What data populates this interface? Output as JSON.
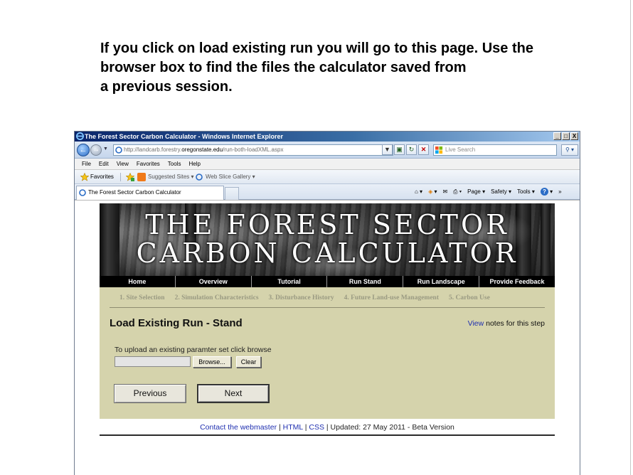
{
  "caption": {
    "lines": [
      "If you click on load existing run you will go to this page.  Use the",
      "browser box to find the files the calculator saved from",
      "a previous session."
    ]
  },
  "browser": {
    "window_title": "The Forest Sector Carbon Calculator - Windows Internet Explorer",
    "window_buttons": [
      "_",
      "□",
      "X"
    ],
    "address": {
      "prefix": "http://landcarb.forestry.",
      "domain": "oregonstate.edu",
      "path": "/run-both-loadXML.aspx"
    },
    "search_placeholder": "Live Search",
    "menu": [
      "File",
      "Edit",
      "View",
      "Favorites",
      "Tools",
      "Help"
    ],
    "favorites_label": "Favorites",
    "suggested_sites": "Suggested Sites ▾",
    "web_slice_gallery": "Web Slice Gallery ▾",
    "tab_title": "The Forest Sector Carbon Calculator",
    "command_bar": {
      "page": "Page ▾",
      "safety": "Safety ▾",
      "tools": "Tools ▾"
    }
  },
  "site": {
    "banner": {
      "line1": "THE FOREST SECTOR",
      "line2": "CARBON CALCULATOR"
    },
    "nav": [
      "Home",
      "Overview",
      "Tutorial",
      "Run Stand",
      "Run Landscape",
      "Provide Feedback"
    ],
    "steps": [
      "1. Site Selection",
      "2. Simulation Characteristics",
      "3. Disturbance History",
      "4. Future Land-use Management",
      "5. Carbon Use"
    ],
    "page_title": "Load Existing Run - Stand",
    "notes": {
      "link": "View",
      "text": " notes for this step"
    },
    "upload_label": "To upload an existing paramter set click browse",
    "browse_button": "Browse...",
    "clear_button": "Clear",
    "previous_button": "Previous",
    "next_button": "Next",
    "footer": {
      "contact": "Contact the webmaster",
      "sep1": " | ",
      "html": "HTML",
      "sep2": " | ",
      "css": "CSS",
      "updated": " | Updated: 27 May 2011 - Beta Version"
    }
  },
  "colors": {
    "panel": "#d5d3ac",
    "nav_bg": "#000000",
    "link": "#1f2fb0"
  }
}
